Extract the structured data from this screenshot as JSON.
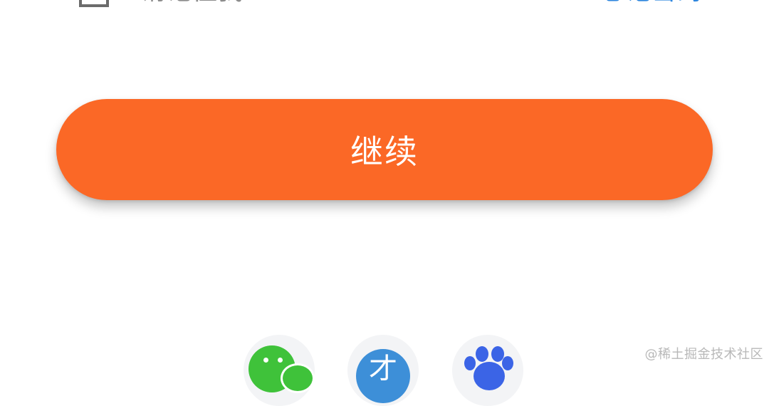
{
  "top_bar": {
    "left_text": "请记住我",
    "right_link": "忘记密码"
  },
  "main": {
    "continue_label": "继续"
  },
  "social_login": [
    {
      "icon": "wechat-icon",
      "color": "#3fc23a"
    },
    {
      "icon": "weibo-icon",
      "color": "#3d8fd8",
      "glyph": "才"
    },
    {
      "icon": "baidu-icon",
      "color": "#3b64e6"
    }
  ],
  "watermark": "@稀土掘金技术社区",
  "colors": {
    "accent": "#fb6826",
    "link": "#2e86de"
  }
}
